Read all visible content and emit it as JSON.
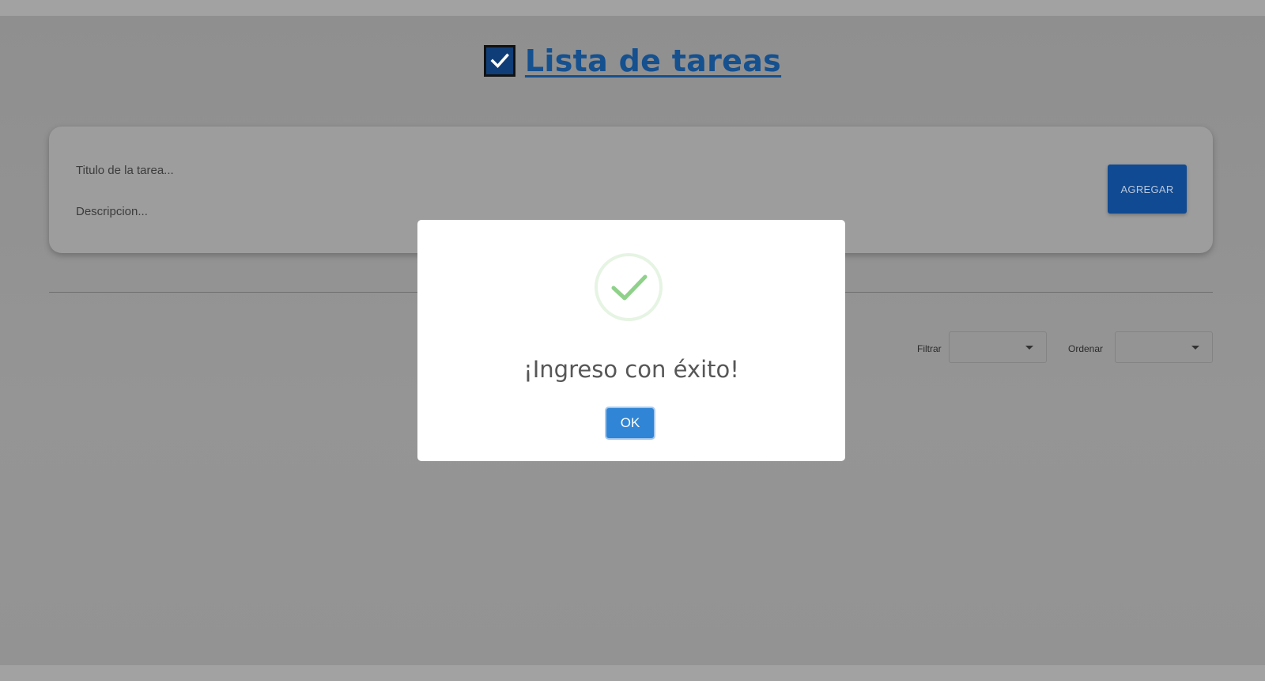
{
  "header": {
    "title": "Lista de tareas",
    "logo_icon": "checkbox-checked-icon",
    "logo_color": "#0f3d77",
    "title_color": "#15508f"
  },
  "form": {
    "title_placeholder": "Titulo de la tarea...",
    "description_placeholder": "Descripcion...",
    "add_label": "AGREGAR",
    "accent": "#104a92"
  },
  "controls": {
    "filter_label": "Filtrar",
    "sort_label": "Ordenar",
    "caret_icon": "caret-down-icon"
  },
  "modal": {
    "title": "¡Ingreso con éxito!",
    "ok_label": "OK",
    "icon": "success-check-icon",
    "icon_color": "#8fd18a",
    "button_color": "#3085d6"
  }
}
